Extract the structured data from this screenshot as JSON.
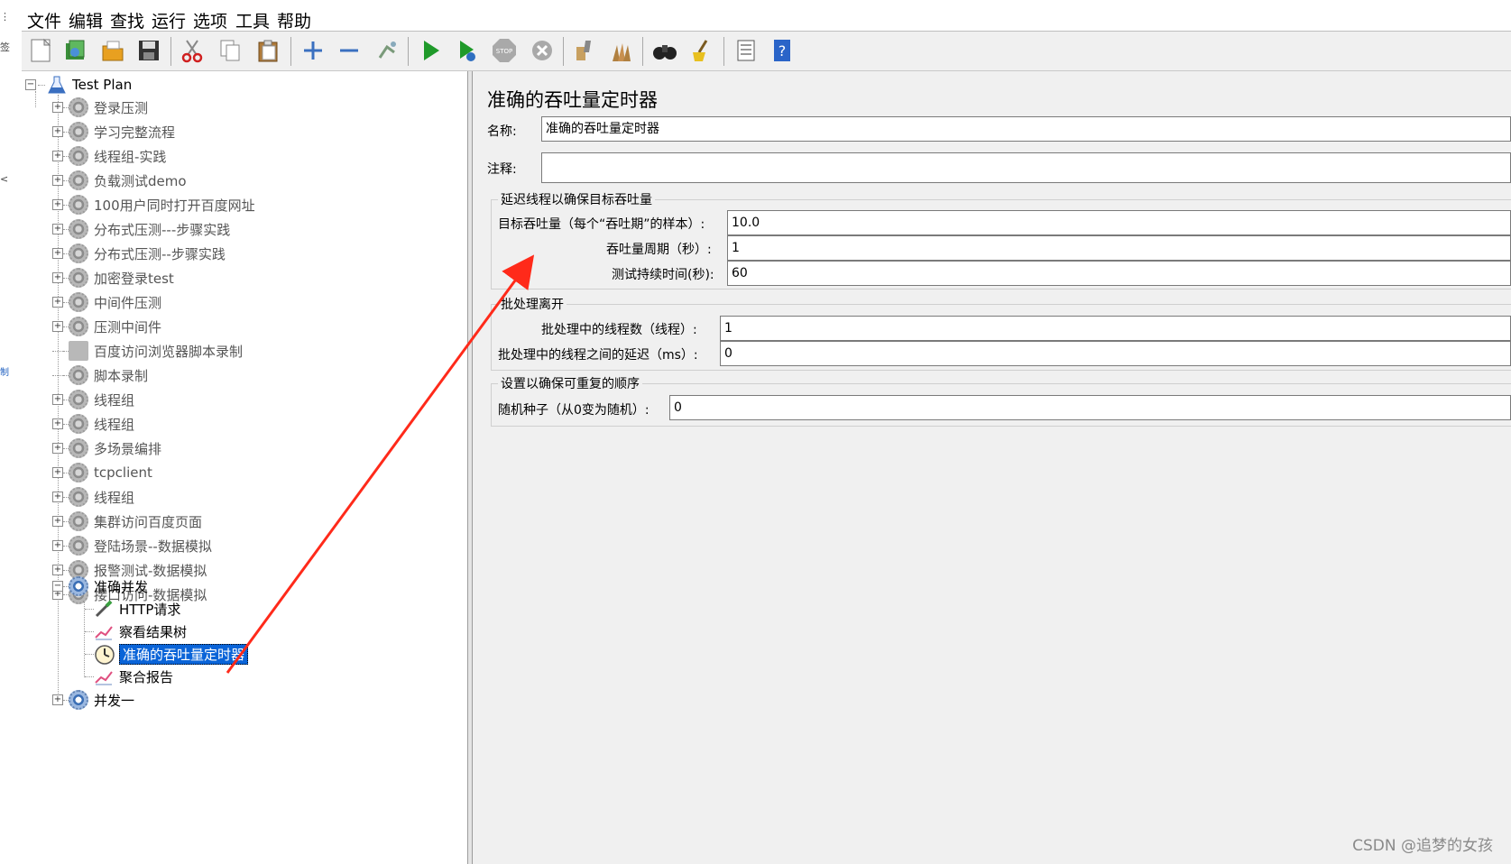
{
  "left_strip_glyphs": [
    "⋮",
    "签",
    "<",
    "制"
  ],
  "menu": [
    "文件",
    "编辑",
    "查找",
    "运行",
    "选项",
    "工具",
    "帮助"
  ],
  "toolbar_icons": [
    "new-icon",
    "templates-icon",
    "open-icon",
    "save-icon",
    "cut-icon",
    "copy-icon",
    "paste-icon",
    "expand-icon",
    "collapse-icon",
    "toggle-icon",
    "start-icon",
    "start-no-pause-icon",
    "stop-icon",
    "shutdown-icon",
    "clear-icon",
    "clear-all-icon",
    "search-icon",
    "reset-search-icon",
    "function-helper-icon",
    "help-icon"
  ],
  "tree": {
    "root": "Test Plan",
    "items": [
      "登录压测",
      "学习完整流程",
      "线程组-实践",
      "负载测试demo",
      "100用户同时打开百度网址",
      "分布式压测---步骤实践",
      "分布式压测--步骤实践",
      "加密登录test",
      "中间件压测",
      "压测中间件",
      "百度访问浏览器脚本录制",
      "脚本录制",
      "线程组",
      "线程组",
      "多场景编排",
      "tcpclient",
      "线程组",
      "集群访问百度页面",
      "登陆场景--数据模拟",
      "报警测试-数据模拟",
      "接口访问-数据模拟"
    ],
    "expanded": "准确并发",
    "children": [
      "HTTP请求",
      "察看结果树",
      "准确的吞吐量定时器",
      "聚合报告"
    ],
    "last": "并发一"
  },
  "panel": {
    "title": "准确的吞吐量定时器",
    "name_label": "名称:",
    "name_value": "准确的吞吐量定时器",
    "comment_label": "注释:",
    "comment_value": "",
    "group1_title": "延迟线程以确保目标吞吐量",
    "target_label": "目标吞吐量（每个“吞吐期”的样本）:",
    "target_value": "10.0",
    "period_label": "吞吐量周期（秒）:",
    "period_value": "1",
    "duration_label": "测试持续时间(秒):",
    "duration_value": "60",
    "group2_title": "批处理离开",
    "batch_threads_label": "批处理中的线程数（线程）:",
    "batch_threads_value": "1",
    "batch_delay_label": "批处理中的线程之间的延迟（ms）:",
    "batch_delay_value": "0",
    "group3_title": "设置以确保可重复的顺序",
    "seed_label": "随机种子（从0变为随机）:",
    "seed_value": "0"
  },
  "colors": {
    "selection": "#0a64d8",
    "arrow": "#ff2a1a"
  },
  "watermark": "CSDN @追梦的女孩"
}
